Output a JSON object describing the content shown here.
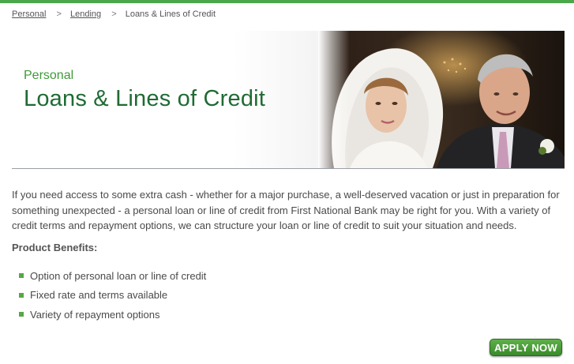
{
  "breadcrumb": {
    "items": [
      "Personal",
      "Lending"
    ],
    "current": "Loans & Lines of Credit",
    "separator": ">"
  },
  "hero": {
    "eyebrow": "Personal",
    "title": "Loans & Lines of Credit"
  },
  "main": {
    "intro": "If you need access to some extra cash - whether for a major purchase, a well-deserved vacation or just in preparation for something unexpected - a personal loan or line of credit from First National Bank may be right for you. With a variety of credit terms and repayment options, we can structure your loan or line of credit to suit your situation and needs.",
    "benefits_heading": "Product Benefits:",
    "benefits": [
      "Option of personal loan or line of credit",
      "Fixed rate and terms available",
      "Variety of repayment options"
    ]
  },
  "actions": {
    "apply_label": "APPLY NOW"
  },
  "colors": {
    "brand_green": "#1f6b34",
    "accent_green": "#3f9a3a",
    "button_green": "#4c9d3b",
    "top_bar": "#4aa84a"
  }
}
